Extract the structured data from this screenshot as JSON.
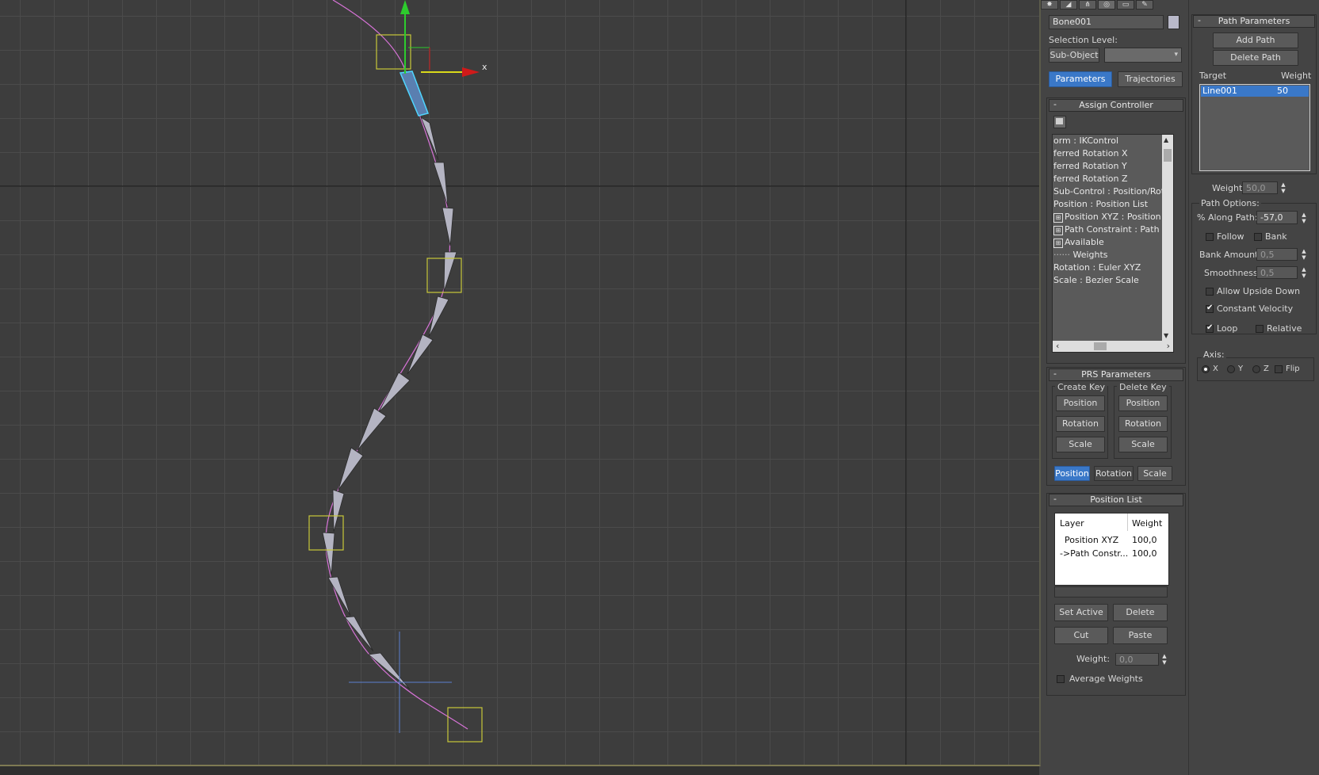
{
  "viewport": {
    "axis_x_label": "x"
  },
  "command_panel": {
    "object_name": "Bone001",
    "selection_level_label": "Selection Level:",
    "sub_object_button": "Sub-Object",
    "tabs": {
      "parameters": "Parameters",
      "trajectories": "Trajectories"
    },
    "assign_controller": {
      "title": "Assign Controller",
      "items": [
        "orm : IKControl",
        "ferred Rotation X",
        "ferred Rotation Y",
        "ferred Rotation Z",
        "Sub-Control : Position/Rotati",
        "Position : Position List",
        "Position XYZ : Position XY",
        "Path Constraint : Path Co",
        "Available",
        "Weights",
        "Rotation : Euler XYZ",
        "Scale : Bezier Scale"
      ]
    },
    "prs_parameters": {
      "title": "PRS Parameters",
      "create_key_label": "Create Key",
      "delete_key_label": "Delete Key",
      "buttons": {
        "position": "Position",
        "rotation": "Rotation",
        "scale": "Scale"
      },
      "bottom_tabs": {
        "position": "Position",
        "rotation": "Rotation",
        "scale": "Scale"
      }
    },
    "position_list": {
      "title": "Position List",
      "headers": {
        "layer": "Layer",
        "weight": "Weight"
      },
      "rows": [
        {
          "layer": "Position XYZ",
          "weight": "100,0"
        },
        {
          "layer": "->Path Constr...",
          "weight": "100,0"
        }
      ],
      "set_active": "Set Active",
      "delete": "Delete",
      "cut": "Cut",
      "paste": "Paste",
      "weight_label": "Weight:",
      "weight_value": "0,0",
      "average_weights": "Average Weights"
    }
  },
  "path_parameters": {
    "title": "Path Parameters",
    "add_path": "Add Path",
    "delete_path": "Delete Path",
    "target_header": "Target",
    "weight_header": "Weight",
    "targets": [
      {
        "name": "Line001",
        "weight": "50"
      }
    ],
    "weight_label": "Weight",
    "weight_value": "50,0",
    "path_options_label": "Path Options:",
    "along_path_label": "% Along Path:",
    "along_path_value": "-57,0",
    "follow_label": "Follow",
    "bank_label": "Bank",
    "bank_amount_label": "Bank Amount:",
    "bank_amount_value": "0,5",
    "smoothness_label": "Smoothness:",
    "smoothness_value": "0,5",
    "allow_upside_down_label": "Allow Upside Down",
    "constant_velocity_label": "Constant Velocity",
    "loop_label": "Loop",
    "relative_label": "Relative",
    "axis_label": "Axis:",
    "axis_x": "X",
    "axis_y": "Y",
    "axis_z": "Z",
    "flip_label": "Flip"
  }
}
